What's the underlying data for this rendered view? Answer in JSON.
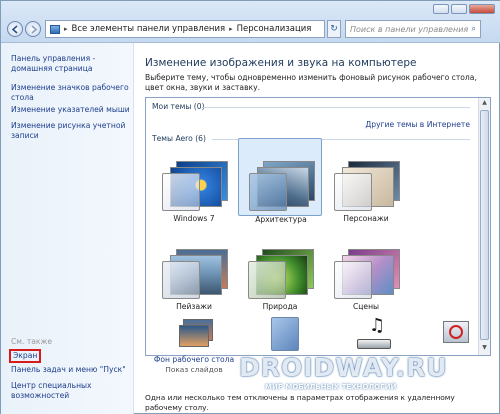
{
  "address": {
    "root": "Все элементы панели управления",
    "current": "Персонализация"
  },
  "search": {
    "placeholder": "Поиск в панели управления"
  },
  "sidebar": {
    "home": "Панель управления - домашняя страница",
    "items": [
      {
        "label": "Изменение значков рабочего стола"
      },
      {
        "label": "Изменение указателей мыши"
      },
      {
        "label": "Изменение рисунка учетной записи"
      }
    ],
    "see_also": "См. также",
    "links": [
      {
        "label": "Экран"
      },
      {
        "label": "Панель задач и меню \"Пуск\""
      },
      {
        "label": "Центр специальных возможностей"
      }
    ]
  },
  "main": {
    "title": "Изменение изображения и звука на компьютере",
    "description": "Выберите тему, чтобы одновременно изменить фоновый рисунок рабочего стола, цвет окна, звуки и заставку.",
    "my_themes": "Мои темы (0)",
    "more_themes": "Другие темы в Интернете",
    "aero_themes": "Темы Aero (6)",
    "themes": [
      {
        "name": "Windows 7"
      },
      {
        "name": "Архитектура"
      },
      {
        "name": "Персонажи"
      },
      {
        "name": "Пейзажи"
      },
      {
        "name": "Природа"
      },
      {
        "name": "Сцены"
      }
    ],
    "selected_theme": "Архитектура"
  },
  "bottom": {
    "options": [
      {
        "title": "Фон рабочего стола",
        "subtitle": "Показ слайдов"
      },
      {
        "title": "",
        "subtitle": ""
      },
      {
        "title": "",
        "subtitle": ""
      },
      {
        "title": "",
        "subtitle": ""
      }
    ],
    "note": "Одна или несколько тем отключены в параметрах отображения к удаленному рабочему столу."
  },
  "watermark": {
    "brand": "DROIDWAY.RU",
    "tagline": "МИР МОБИЛЬНЫХ ТЕХНОЛОГИЙ"
  },
  "colors": {
    "link": "#1e3e8c",
    "selection": "#dcebfc",
    "highlight_box": "#d71a1a"
  }
}
